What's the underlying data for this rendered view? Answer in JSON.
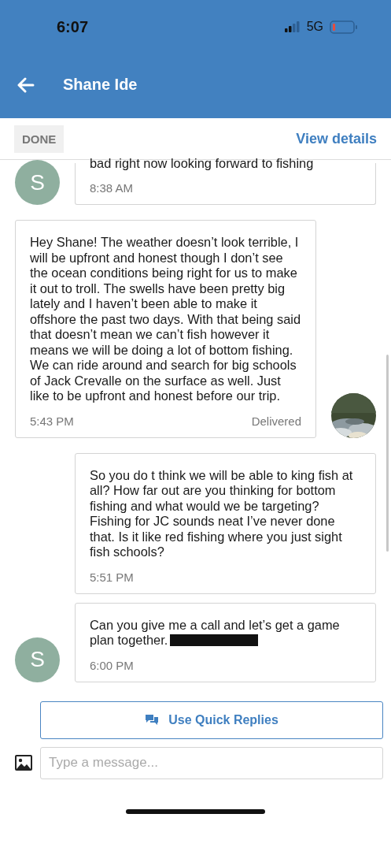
{
  "status_bar": {
    "time": "6:07",
    "network": "5G"
  },
  "header": {
    "title": "Shane Ide"
  },
  "toolbar": {
    "done": "DONE",
    "details": "View details"
  },
  "messages": [
    {
      "kind": "received",
      "avatar": "S",
      "text": "bad right now looking forward to fishing",
      "time": "8:38 AM"
    },
    {
      "kind": "sent",
      "text": "Hey Shane! The weather doesn’t look terrible, I will be upfront and honest though I don’t see the ocean conditions being right for us to make it out to troll. The swells have been pretty big lately and I haven’t been able to make it offshore the past two days. With that being said that doesn’t mean we can’t fish however it means we will be doing a lot of bottom fishing. We can ride around and search for big schools of Jack Crevalle on the surface as well. Just like to be upfront and honest before our trip.",
      "time": "5:43 PM",
      "status": "Delivered"
    },
    {
      "kind": "received",
      "text": "So you do t think we will be able to king fish at all?  How far out are you thinking for bottom fishing and what would we be targeting? Fishing for JC sounds neat I’ve never done that. Is it like red fishing where you just sight fish schools?",
      "time": "5:51 PM"
    },
    {
      "kind": "received",
      "avatar": "S",
      "text": "Can you give me a call and let’s get a game plan together.",
      "time": "6:00 PM",
      "redacted": true
    }
  ],
  "quick_replies": "Use Quick Replies",
  "composer": {
    "placeholder": "Type a message..."
  }
}
